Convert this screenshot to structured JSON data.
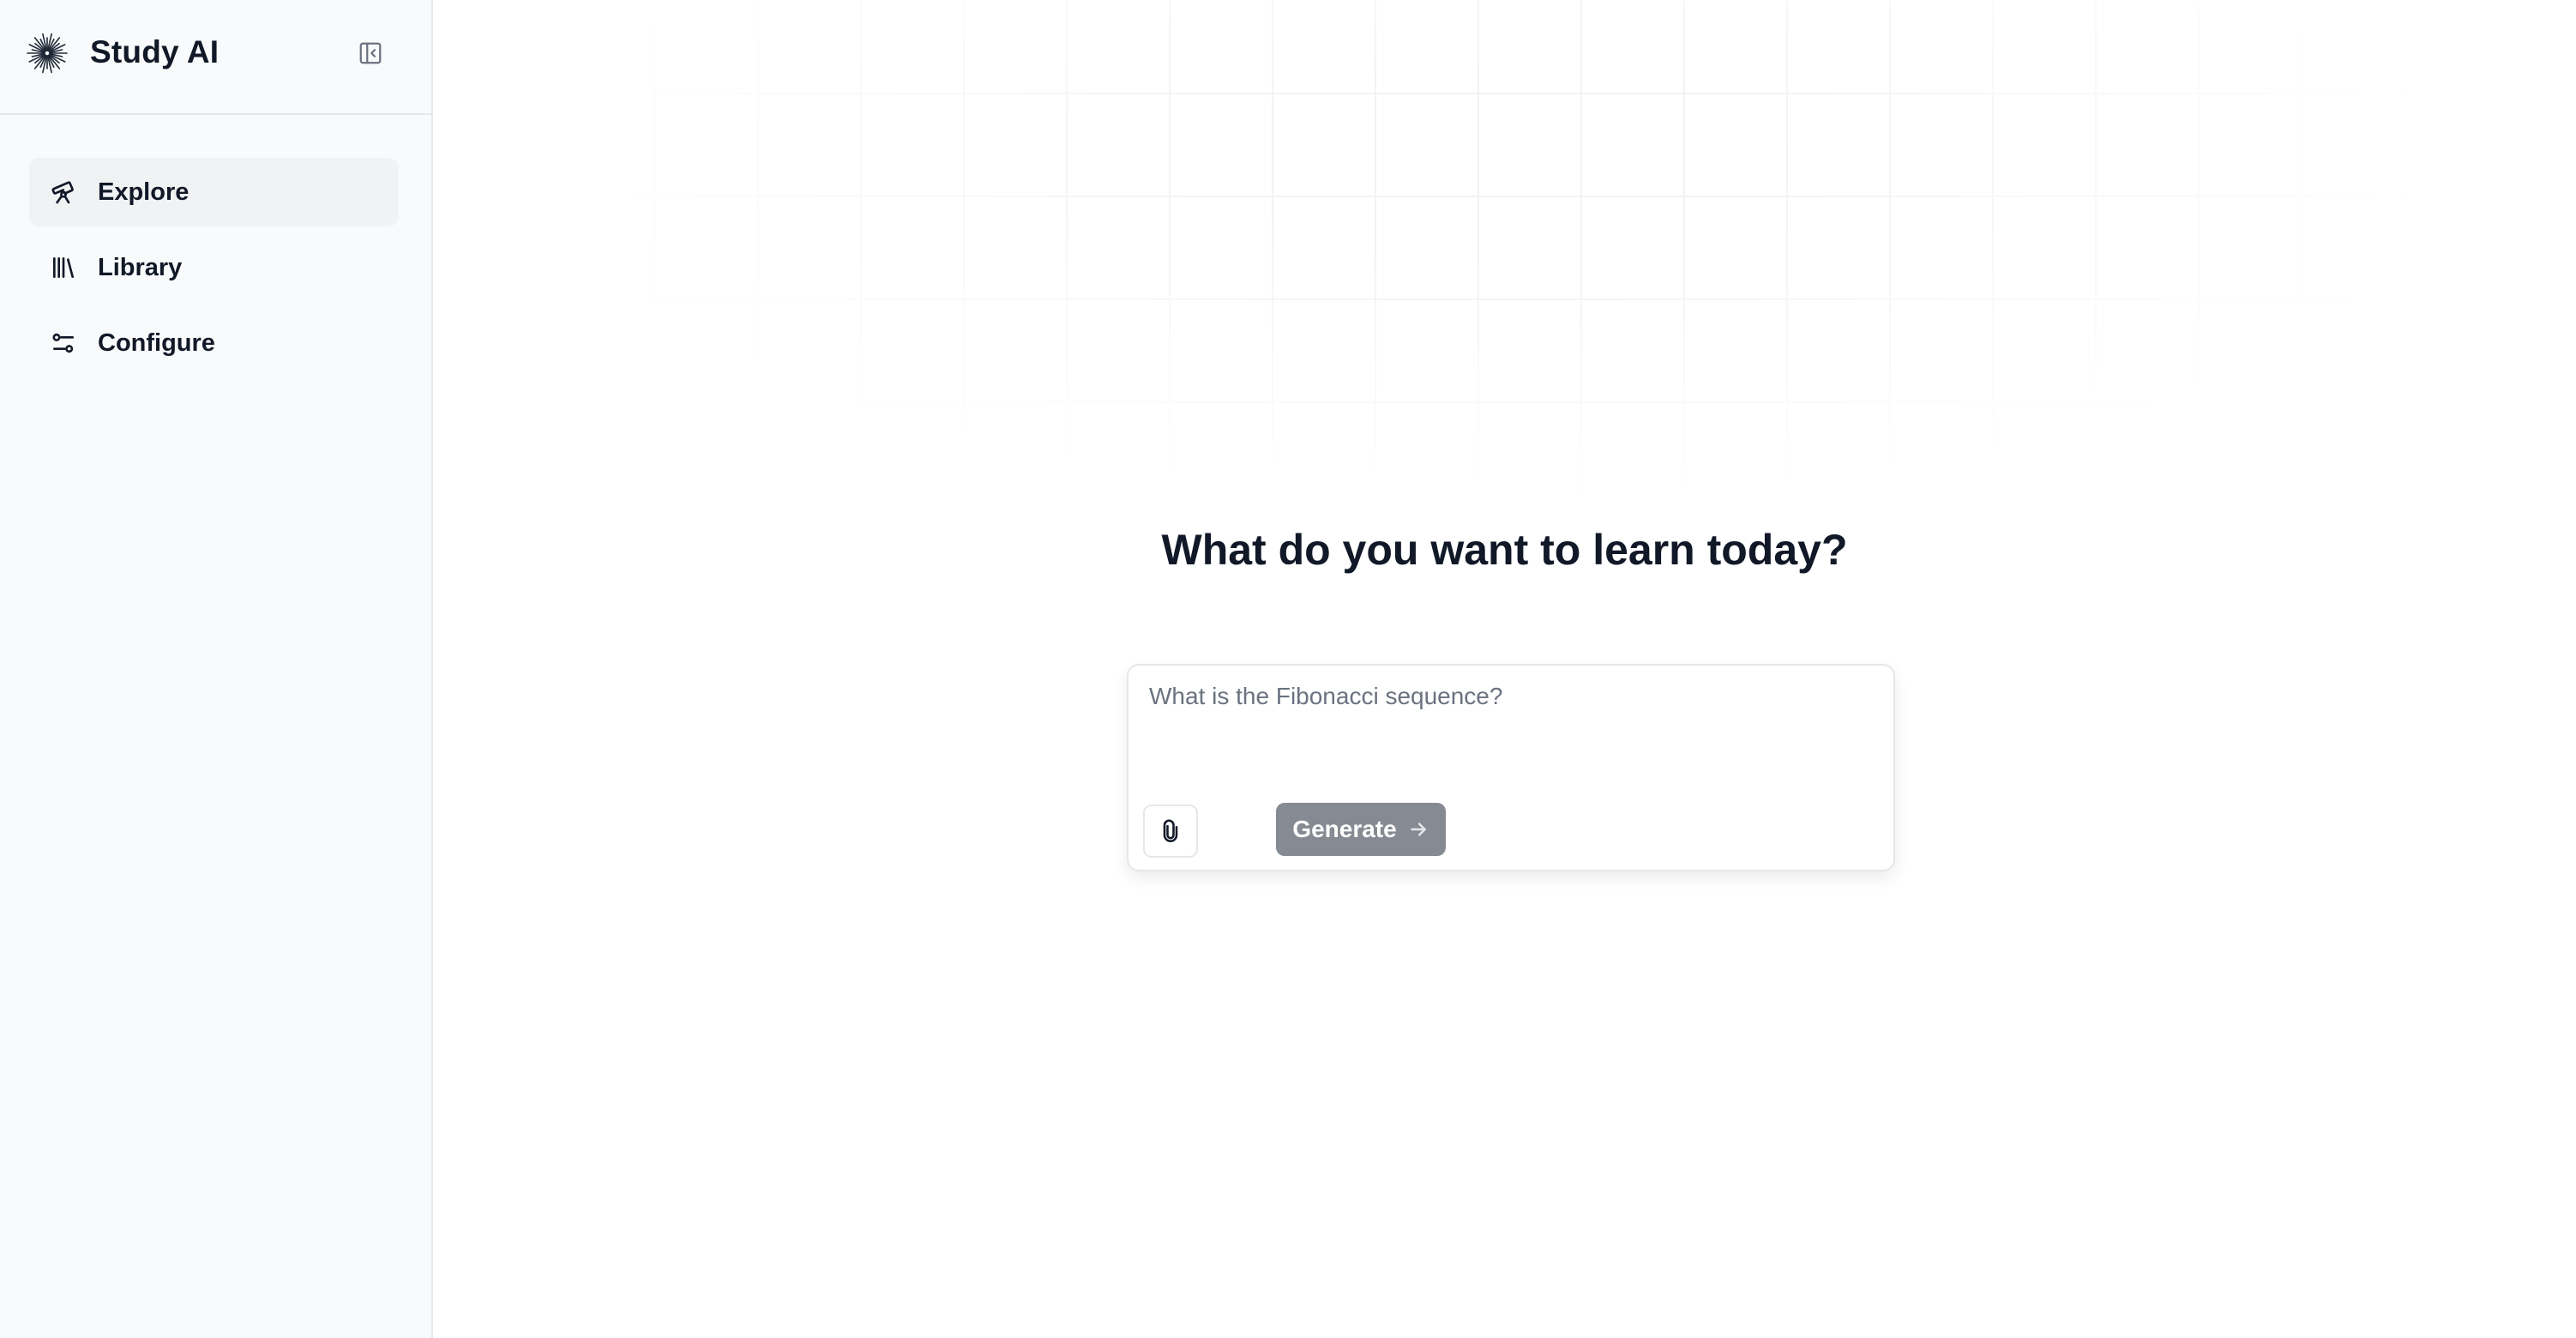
{
  "app": {
    "brand": "Study AI",
    "logo_icon": "sunburst-logo-icon"
  },
  "sidebar": {
    "collapse_icon": "sidebar-collapse-icon",
    "items": [
      {
        "label": "Explore",
        "icon": "telescope-icon",
        "active": true
      },
      {
        "label": "Library",
        "icon": "library-icon",
        "active": false
      },
      {
        "label": "Configure",
        "icon": "sliders-icon",
        "active": false
      }
    ]
  },
  "main": {
    "headline": "What do you want to learn today?",
    "prompt": {
      "placeholder": "What is the Fibonacci sequence?",
      "value": "",
      "attach_icon": "paperclip-icon",
      "generate_label": "Generate",
      "generate_icon": "arrow-right-icon"
    }
  },
  "colors": {
    "sidebar_bg": "#f9fafb",
    "active_item_bg": "#f1f2f4",
    "generate_button_bg": "#868a92",
    "text": "#111827"
  }
}
